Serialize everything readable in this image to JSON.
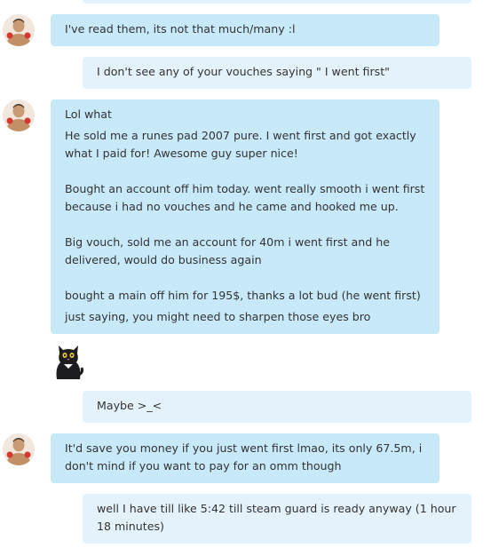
{
  "messages": [
    {
      "id": "m0",
      "direction": "outgoing",
      "lines": [
        ""
      ]
    },
    {
      "id": "m1",
      "direction": "incoming",
      "lines": [
        "I've read them, its not that much/many :l"
      ]
    },
    {
      "id": "m2",
      "direction": "outgoing",
      "lines": [
        "I don't see any of your vouches saying \" I went first\""
      ]
    },
    {
      "id": "m3",
      "direction": "incoming",
      "lines": [
        "Lol what",
        "He sold me a runes pad 2007 pure. I went first and got exactly what I paid for! Awesome guy super nice!",
        "",
        "Bought an account off him today. went really smooth i went first because i had no vouches and he came and hooked me up.",
        "",
        "Big vouch, sold me an account for 40m i went first and he delivered, would do business again",
        "",
        "bought a main off him for 195$, thanks a lot bud (he went first)",
        "just saying, you might need to sharpen those eyes bro"
      ]
    },
    {
      "id": "m4",
      "direction": "incoming",
      "sticker": "black-cat-sticker"
    },
    {
      "id": "m5",
      "direction": "outgoing",
      "lines": [
        "Maybe >_<"
      ]
    },
    {
      "id": "m6",
      "direction": "incoming",
      "lines": [
        "It'd save you money if you just went first lmao, its only 67.5m, i don't mind if you want to pay for an omm though"
      ]
    },
    {
      "id": "m7",
      "direction": "outgoing",
      "lines": [
        "well I have till like 5:42 till steam guard is ready anyway (1 hour 18 minutes)"
      ]
    }
  ],
  "colors": {
    "incoming_bubble": "#c7e9fa",
    "outgoing_bubble": "#e4f3fb",
    "text": "#333333"
  }
}
